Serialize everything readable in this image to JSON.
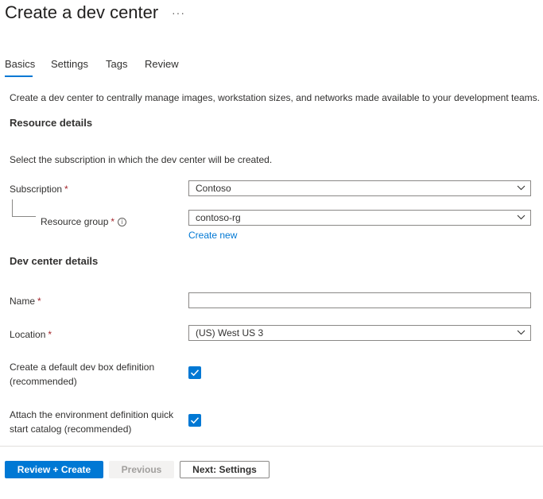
{
  "page": {
    "title": "Create a dev center",
    "more_label": "···"
  },
  "tabs": [
    {
      "label": "Basics",
      "active": true
    },
    {
      "label": "Settings",
      "active": false
    },
    {
      "label": "Tags",
      "active": false
    },
    {
      "label": "Review",
      "active": false
    }
  ],
  "intro": "Create a dev center to centrally manage images, workstation sizes, and networks made available to your development teams.",
  "resource_details": {
    "heading": "Resource details",
    "description": "Select the subscription in which the dev center will be created.",
    "subscription": {
      "label": "Subscription",
      "required_mark": "*",
      "value": "Contoso"
    },
    "resource_group": {
      "label": "Resource group",
      "required_mark": "*",
      "info_icon": "i",
      "value": "contoso-rg",
      "create_new": "Create new"
    }
  },
  "dev_center_details": {
    "heading": "Dev center details",
    "name": {
      "label": "Name",
      "required_mark": "*",
      "value": ""
    },
    "location": {
      "label": "Location",
      "required_mark": "*",
      "value": "(US) West US 3"
    },
    "default_dev_box": {
      "label_line1": "Create a default dev box definition",
      "label_line2": "(recommended)",
      "checked": true
    },
    "env_catalog": {
      "label_line1": "Attach the environment definition quick",
      "label_line2": "start catalog (recommended)",
      "checked": true
    }
  },
  "footer": {
    "review_create": "Review + Create",
    "previous": "Previous",
    "next": "Next: Settings"
  },
  "colors": {
    "accent": "#0078d4",
    "required": "#a4262c",
    "disabled_bg": "#f3f2f1"
  },
  "icons": {
    "dropdown": "chevron-down-icon",
    "info": "info-icon",
    "checkbox": "checkmark-icon"
  }
}
